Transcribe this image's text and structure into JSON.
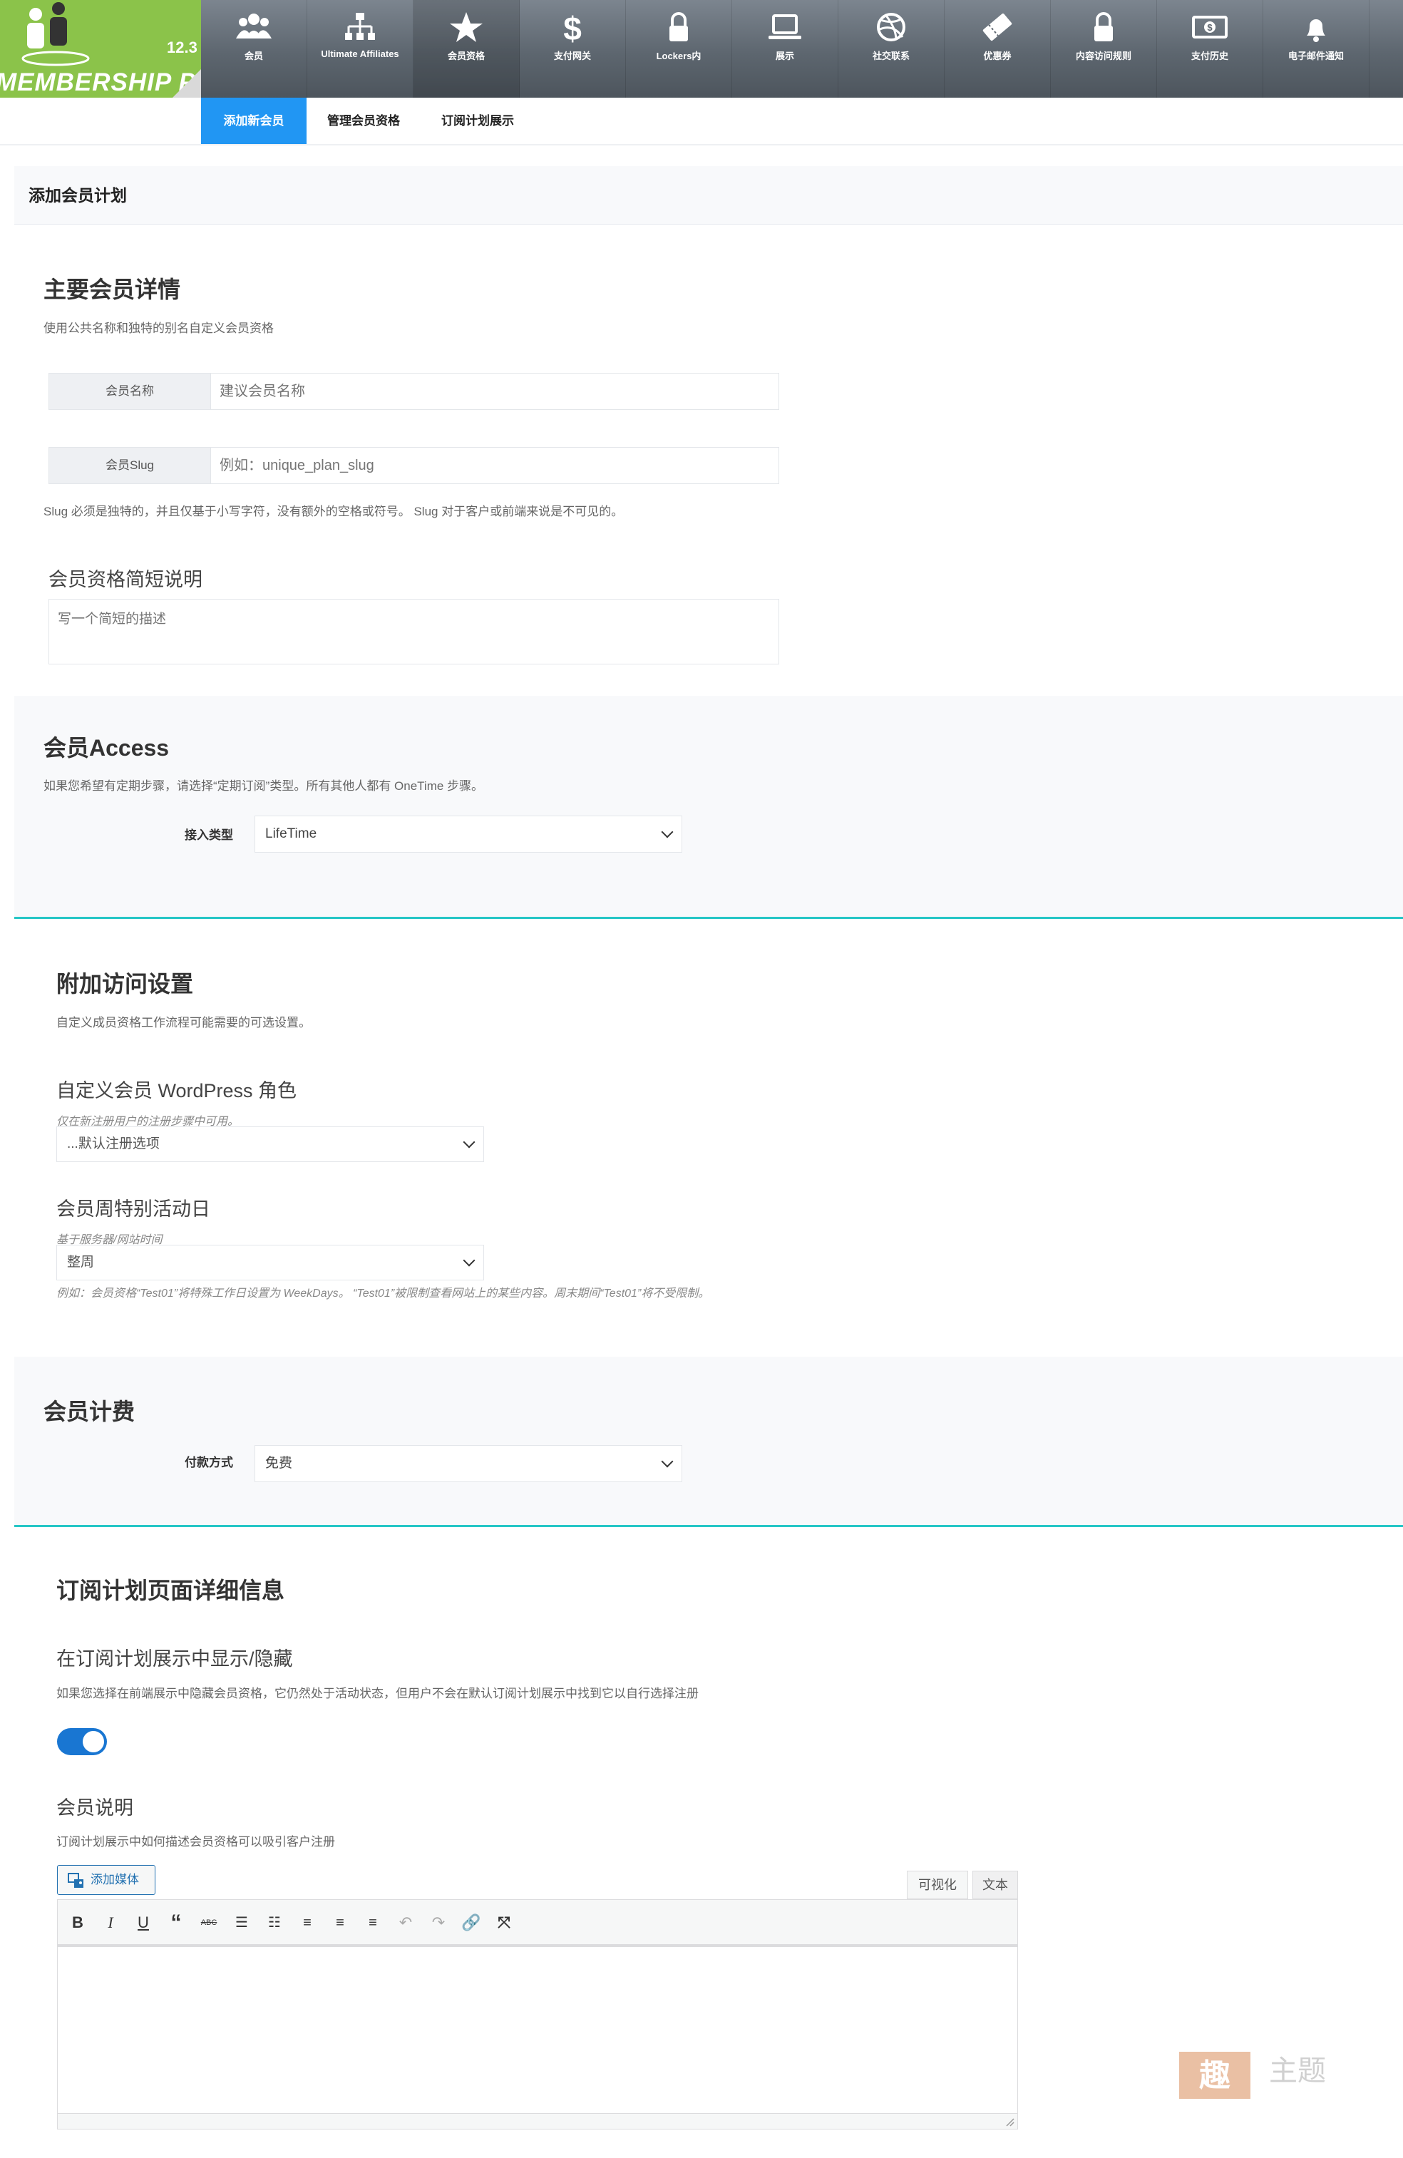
{
  "logo": {
    "version": "12.3",
    "brand": "MEMBERSHIP PRO"
  },
  "nav": [
    {
      "label": "会员",
      "icon": "users-icon"
    },
    {
      "label": "Ultimate Affiliates",
      "icon": "sitemap-icon"
    },
    {
      "label": "会员资格",
      "icon": "star-icon"
    },
    {
      "label": "支付网关",
      "icon": "dollar-icon"
    },
    {
      "label": "Lockers内",
      "icon": "lock-icon"
    },
    {
      "label": "展示",
      "icon": "laptop-icon"
    },
    {
      "label": "社交联系",
      "icon": "dribbble-icon"
    },
    {
      "label": "优惠券",
      "icon": "ticket-icon"
    },
    {
      "label": "内容访问规则",
      "icon": "lock-icon"
    },
    {
      "label": "支付历史",
      "icon": "money-icon"
    },
    {
      "label": "电子邮件通知",
      "icon": "bell-icon"
    }
  ],
  "tabs": [
    "添加新会员",
    "管理会员资格",
    "订阅计划展示"
  ],
  "page_title": "添加会员计划",
  "main_details": {
    "title": "主要会员详情",
    "description": "使用公共名称和独特的别名自定义会员资格",
    "name_label": "会员名称",
    "name_placeholder": "建议会员名称",
    "slug_label": "会员Slug",
    "slug_placeholder": "例如：unique_plan_slug",
    "slug_note": "Slug 必须是独特的，并且仅基于小写字符，没有额外的空格或符号。 Slug 对于客户或前端来说是不可见的。",
    "short_desc_title": "会员资格简短说明",
    "short_desc_placeholder": "写一个简短的描述"
  },
  "access": {
    "title": "会员Access",
    "description": "如果您希望有定期步骤，请选择“定期订阅”类型。所有其他人都有 OneTime 步骤。",
    "type_label": "接入类型",
    "type_value": "LifeTime"
  },
  "additional": {
    "title": "附加访问设置",
    "description": "自定义成员资格工作流程可能需要的可选设置。",
    "role_title": "自定义会员 WordPress 角色",
    "role_note": "仅在新注册用户的注册步骤中可用。",
    "role_value": "...默认注册选项",
    "weekday_title": "会员周特别活动日",
    "weekday_note": "基于服务器/网站时间",
    "weekday_value": "整周",
    "weekday_example": "例如：会员资格“Test01”将特殊工作日设置为 WeekDays。 “Test01”被限制查看网站上的某些内容。周末期间“Test01”将不受限制。"
  },
  "billing": {
    "title": "会员计费",
    "payment_label": "付款方式",
    "payment_value": "免费"
  },
  "plan_page": {
    "title": "订阅计划页面详细信息",
    "show_title": "在订阅计划展示中显示/隐藏",
    "show_desc": "如果您选择在前端展示中隐藏会员资格，它仍然处于活动状态，但用户不会在默认订阅计划展示中找到它以自行选择注册",
    "show_enabled": true,
    "member_desc_title": "会员说明",
    "member_desc_note": "订阅计划展示中如何描述会员资格可以吸引客户注册",
    "add_media": "添加媒体",
    "visual_tab": "可视化",
    "text_tab": "文本"
  },
  "watermark": {
    "chars": "主题",
    "seal": "趣"
  },
  "colors": {
    "accent": "#2196f3",
    "logo_green": "#8bc34a",
    "teal_divider": "#26c6c6",
    "toggle_on": "#1976d2"
  }
}
